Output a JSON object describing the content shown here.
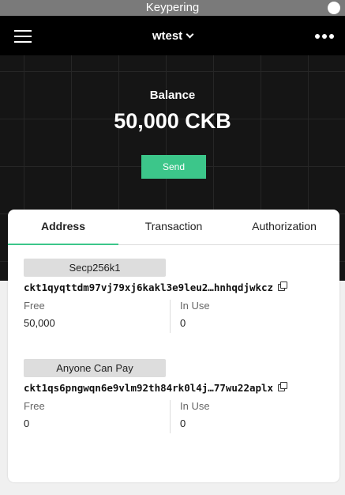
{
  "window": {
    "title": "Keypering"
  },
  "appbar": {
    "wallet_name": "wtest",
    "menu_icon": "hamburger-menu-icon",
    "more_icon": "more-dots-icon"
  },
  "hero": {
    "balance_label": "Balance",
    "balance_value": "50,000 CKB",
    "send_label": "Send"
  },
  "tabs": [
    {
      "label": "Address",
      "active": true
    },
    {
      "label": "Transaction",
      "active": false
    },
    {
      "label": "Authorization",
      "active": false
    }
  ],
  "addresses": [
    {
      "lock": "Secp256k1",
      "address": "ckt1qyqttdm97vj79xj6kakl3e9leu2…hnhqdjwkcz",
      "free_label": "Free",
      "free": "50,000",
      "inuse_label": "In Use",
      "inuse": "0"
    },
    {
      "lock": "Anyone Can Pay",
      "address": "ckt1qs6pngwqn6e9vlm92th84rk0l4j…77wu22aplx",
      "free_label": "Free",
      "free": "0",
      "inuse_label": "In Use",
      "inuse": "0"
    }
  ],
  "colors": {
    "accent": "#3cc68a",
    "appbar": "#000000",
    "titlebar": "#7a7a7a"
  }
}
